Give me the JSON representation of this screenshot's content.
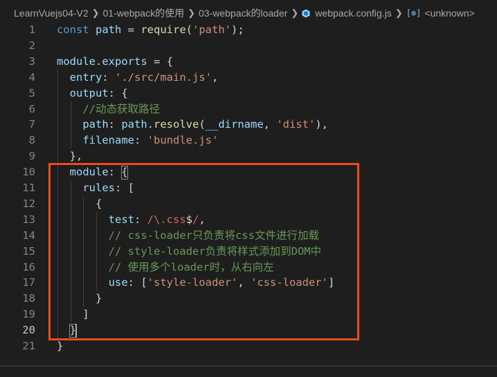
{
  "breadcrumb": {
    "items": [
      "LearnVuejs04-V2",
      "01-webpack的使用",
      "03-webpack的loader",
      "webpack.config.js",
      "<unknown>"
    ],
    "separator": ">"
  },
  "editor": {
    "active_line": 20,
    "lines": [
      {
        "n": "1",
        "tokens": [
          [
            "kw",
            "const "
          ],
          [
            "var",
            "path"
          ],
          [
            "pl",
            " = "
          ],
          [
            "fn",
            "require"
          ],
          [
            "pl",
            "("
          ],
          [
            "str",
            "'path'"
          ],
          [
            "pl",
            ");"
          ]
        ]
      },
      {
        "n": "2",
        "tokens": []
      },
      {
        "n": "3",
        "tokens": [
          [
            "var",
            "module"
          ],
          [
            "pl",
            "."
          ],
          [
            "var",
            "exports"
          ],
          [
            "pl",
            " = {"
          ]
        ]
      },
      {
        "n": "4",
        "tokens": [
          [
            "pl",
            "  "
          ],
          [
            "var",
            "entry"
          ],
          [
            "pl",
            ": "
          ],
          [
            "str",
            "'./src/main.js'"
          ],
          [
            "pl",
            ","
          ]
        ]
      },
      {
        "n": "5",
        "tokens": [
          [
            "pl",
            "  "
          ],
          [
            "var",
            "output"
          ],
          [
            "pl",
            ": {"
          ]
        ]
      },
      {
        "n": "6",
        "tokens": [
          [
            "pl",
            "    "
          ],
          [
            "cm",
            "//动态获取路径"
          ]
        ]
      },
      {
        "n": "7",
        "tokens": [
          [
            "pl",
            "    "
          ],
          [
            "var",
            "path"
          ],
          [
            "pl",
            ": "
          ],
          [
            "var",
            "path"
          ],
          [
            "pl",
            "."
          ],
          [
            "fn",
            "resolve"
          ],
          [
            "pl",
            "("
          ],
          [
            "var",
            "__dirname"
          ],
          [
            "pl",
            ", "
          ],
          [
            "str",
            "'dist'"
          ],
          [
            "pl",
            "),"
          ]
        ]
      },
      {
        "n": "8",
        "tokens": [
          [
            "pl",
            "    "
          ],
          [
            "var",
            "filename"
          ],
          [
            "pl",
            ": "
          ],
          [
            "str",
            "'bundle.js'"
          ]
        ]
      },
      {
        "n": "9",
        "tokens": [
          [
            "pl",
            "  },"
          ]
        ]
      },
      {
        "n": "10",
        "tokens": [
          [
            "pl",
            "  "
          ],
          [
            "var",
            "module"
          ],
          [
            "pl",
            ": "
          ],
          [
            "pl",
            "{"
          ]
        ]
      },
      {
        "n": "11",
        "tokens": [
          [
            "pl",
            "    "
          ],
          [
            "var",
            "rules"
          ],
          [
            "pl",
            ": ["
          ]
        ]
      },
      {
        "n": "12",
        "tokens": [
          [
            "pl",
            "      {"
          ]
        ]
      },
      {
        "n": "13",
        "tokens": [
          [
            "pl",
            "        "
          ],
          [
            "var",
            "test"
          ],
          [
            "pl",
            ": "
          ],
          [
            "re",
            "/\\."
          ],
          [
            "re",
            "css"
          ],
          [
            "rx",
            "$"
          ],
          [
            "re",
            "/"
          ],
          [
            "pl",
            ","
          ]
        ]
      },
      {
        "n": "14",
        "tokens": [
          [
            "pl",
            "        "
          ],
          [
            "cm",
            "// css-loader只负责将css文件进行加载"
          ]
        ]
      },
      {
        "n": "15",
        "tokens": [
          [
            "pl",
            "        "
          ],
          [
            "cm",
            "// style-loader负责将样式添加到DOM中"
          ]
        ]
      },
      {
        "n": "16",
        "tokens": [
          [
            "pl",
            "        "
          ],
          [
            "cm",
            "// 使用多个loader时，从右向左"
          ]
        ]
      },
      {
        "n": "17",
        "tokens": [
          [
            "pl",
            "        "
          ],
          [
            "var",
            "use"
          ],
          [
            "pl",
            ": ["
          ],
          [
            "str",
            "'style-loader'"
          ],
          [
            "pl",
            ", "
          ],
          [
            "str",
            "'css-loader'"
          ],
          [
            "pl",
            "]"
          ]
        ]
      },
      {
        "n": "18",
        "tokens": [
          [
            "pl",
            "      }"
          ]
        ]
      },
      {
        "n": "19",
        "tokens": [
          [
            "pl",
            "    ]"
          ]
        ]
      },
      {
        "n": "20",
        "tokens": [
          [
            "pl",
            "  "
          ],
          [
            "pl",
            "}"
          ]
        ]
      },
      {
        "n": "21",
        "tokens": [
          [
            "pl",
            "}"
          ]
        ]
      }
    ]
  },
  "icons": {
    "file": "webpack-file-icon",
    "symbol": "symbol-variable-icon",
    "separator": "chevron-right-icon"
  },
  "colors": {
    "background": "#1e1e1e",
    "highlight_box": "#ee4b1a",
    "keyword": "#569cd6",
    "string": "#ce9178",
    "comment": "#6a9955"
  }
}
